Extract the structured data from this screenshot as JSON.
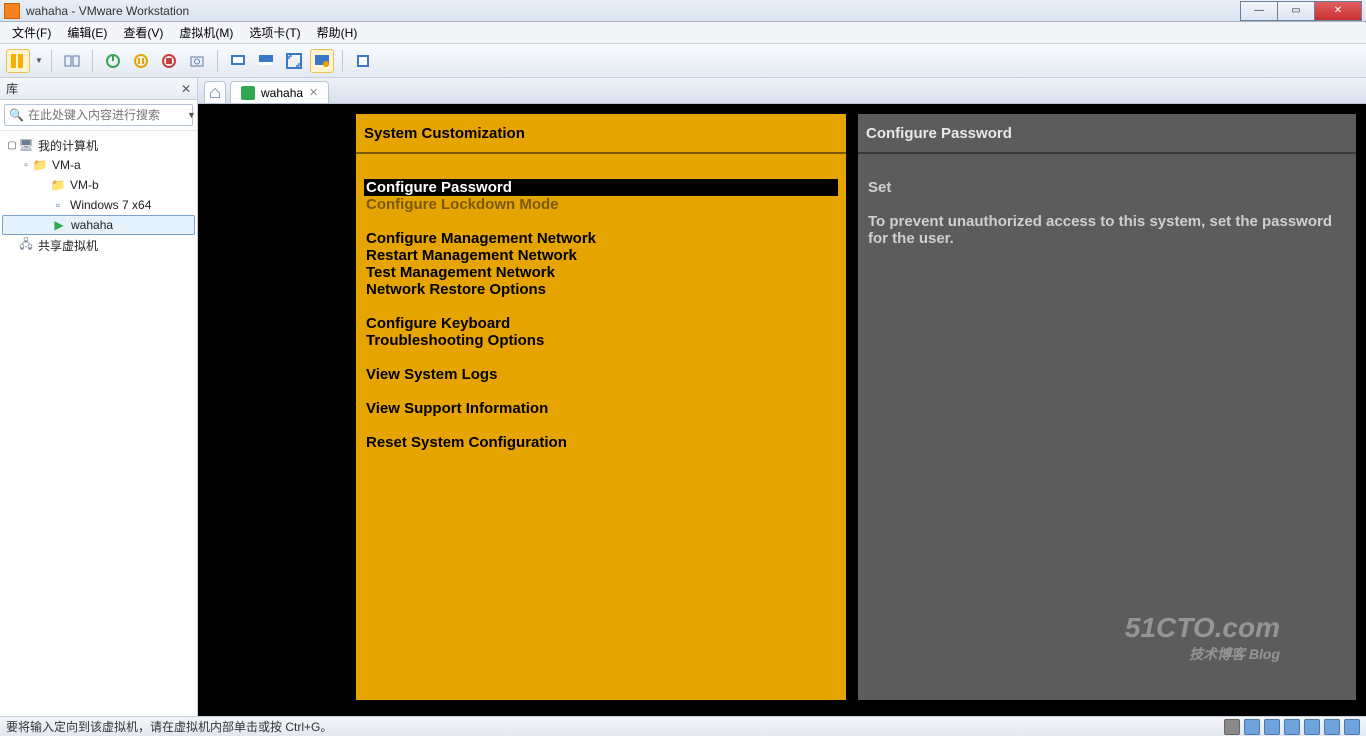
{
  "window": {
    "title": "wahaha - VMware Workstation"
  },
  "menu": {
    "items": [
      "文件(F)",
      "编辑(E)",
      "查看(V)",
      "虚拟机(M)",
      "选项卡(T)",
      "帮助(H)"
    ]
  },
  "sidebar": {
    "header": "库",
    "search_placeholder": "在此处键入内容进行搜索",
    "tree": {
      "root": "我的计算机",
      "items": [
        "VM-a",
        "VM-b",
        "Windows 7 x64",
        "wahaha"
      ],
      "shared": "共享虚拟机"
    }
  },
  "tab": {
    "label": "wahaha"
  },
  "dcui": {
    "left_title": "System Customization",
    "right_title": "Configure Password",
    "menu": [
      {
        "text": "Configure Password",
        "sel": true
      },
      {
        "text": "Configure Lockdown Mode",
        "dim": true
      },
      {
        "gap": true
      },
      {
        "text": "Configure Management Network"
      },
      {
        "text": "Restart Management Network"
      },
      {
        "text": "Test Management Network"
      },
      {
        "text": "Network Restore Options"
      },
      {
        "gap": true
      },
      {
        "text": "Configure Keyboard"
      },
      {
        "text": "Troubleshooting Options"
      },
      {
        "gap": true
      },
      {
        "text": "View System Logs"
      },
      {
        "gap": true
      },
      {
        "text": "View Support Information"
      },
      {
        "gap": true
      },
      {
        "text": "Reset System Configuration"
      }
    ],
    "detail_status": "Set",
    "detail_text": "To prevent unauthorized access to this system, set the password for the user."
  },
  "statusbar": {
    "text": "要将输入定向到该虚拟机，请在虚拟机内部单击或按 Ctrl+G。"
  },
  "watermark": {
    "main": "51CTO.com",
    "sub": "技术博客  Blog"
  }
}
